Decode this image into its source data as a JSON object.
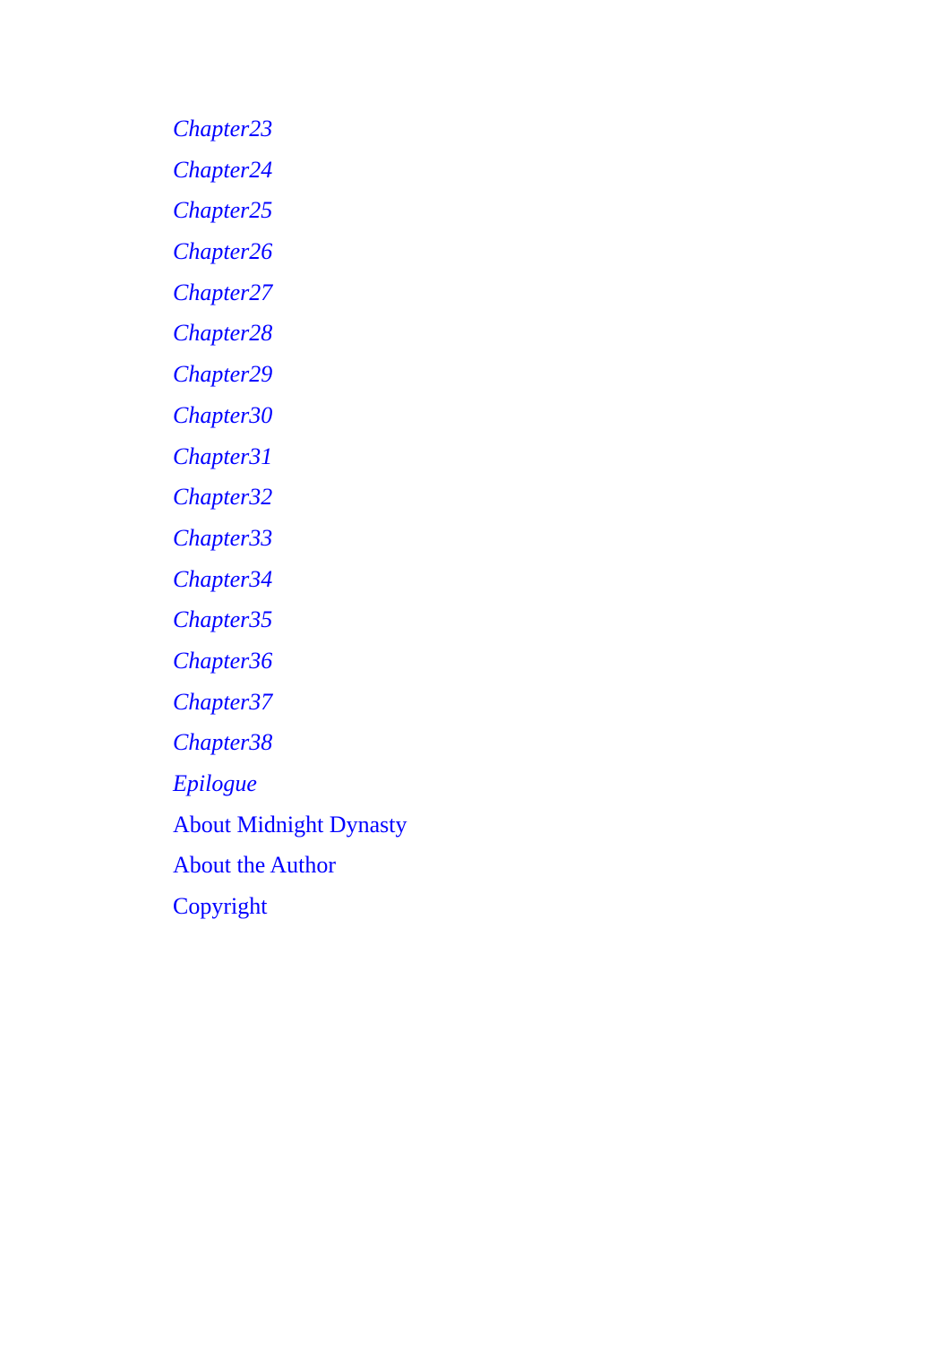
{
  "link_color": "#0000ff",
  "toc": [
    {
      "label": "Chapter23",
      "italic": true
    },
    {
      "label": "Chapter24",
      "italic": true
    },
    {
      "label": "Chapter25",
      "italic": true
    },
    {
      "label": "Chapter26",
      "italic": true
    },
    {
      "label": "Chapter27",
      "italic": true
    },
    {
      "label": "Chapter28",
      "italic": true
    },
    {
      "label": "Chapter29",
      "italic": true
    },
    {
      "label": "Chapter30",
      "italic": true
    },
    {
      "label": "Chapter31",
      "italic": true
    },
    {
      "label": "Chapter32",
      "italic": true
    },
    {
      "label": "Chapter33",
      "italic": true
    },
    {
      "label": "Chapter34",
      "italic": true
    },
    {
      "label": "Chapter35",
      "italic": true
    },
    {
      "label": "Chapter36",
      "italic": true
    },
    {
      "label": "Chapter37",
      "italic": true
    },
    {
      "label": "Chapter38",
      "italic": true
    },
    {
      "label": "Epilogue",
      "italic": true
    },
    {
      "label": "About Midnight Dynasty",
      "italic": false
    },
    {
      "label": "About the Author",
      "italic": false
    },
    {
      "label": "Copyright",
      "italic": false
    }
  ]
}
